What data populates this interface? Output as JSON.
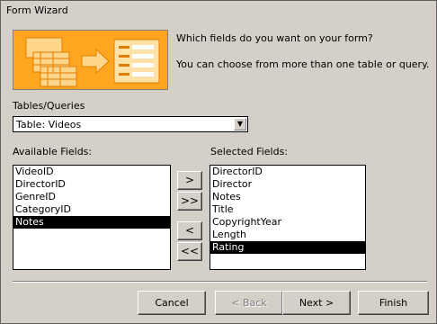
{
  "window": {
    "title": "Form Wizard"
  },
  "header": {
    "question": "Which fields do you want on your form?",
    "hint": "You can choose from more than one table or query."
  },
  "tables_queries": {
    "label": "Tables/Queries",
    "selected": "Table: Videos"
  },
  "available": {
    "label": "Available Fields:",
    "items": [
      "VideoID",
      "DirectorID",
      "GenreID",
      "CategoryID",
      "Notes"
    ],
    "selected_item": "Notes"
  },
  "selected": {
    "label": "Selected Fields:",
    "items": [
      "DirectorID",
      "Director",
      "Notes",
      "Title",
      "CopyrightYear",
      "Length",
      "Rating"
    ],
    "selected_item": "Rating"
  },
  "movers": {
    "add_one": ">",
    "add_all": ">>",
    "remove_one": "<",
    "remove_all": "<<"
  },
  "footer": {
    "cancel": "Cancel",
    "back": "< Back",
    "next": "Next >",
    "finish": "Finish"
  },
  "colors": {
    "banner": "#ffa21a",
    "selection": "#000000",
    "face": "#d4d0c8"
  }
}
